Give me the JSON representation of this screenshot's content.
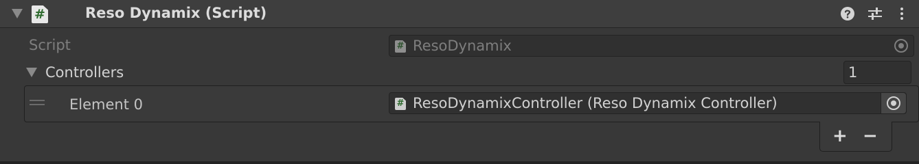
{
  "header": {
    "title": "Reso Dynamix (Script)",
    "script_icon_glyph": "#"
  },
  "script_row": {
    "label": "Script",
    "value": "ResoDynamix"
  },
  "controllers": {
    "label": "Controllers",
    "count": "1",
    "elements": [
      {
        "label": "Element 0",
        "value": "ResoDynamixController (Reso Dynamix Controller)"
      }
    ],
    "add_label": "+",
    "remove_label": "−"
  },
  "icons": {
    "foldout": "triangle-down-icon",
    "script": "script-file-icon",
    "help": "help-icon",
    "presets": "sliders-icon",
    "menu": "kebab-menu-icon",
    "object_picker": "target-icon",
    "drag_handle": "drag-handle-icon"
  },
  "colors": {
    "background": "#383838",
    "header_bg": "#3e3e3e",
    "field_bg": "#303030",
    "field_border": "#232323",
    "text": "#c4c4c4",
    "text_dim": "#7e7e7e",
    "icon_green": "#2d6a2d"
  }
}
